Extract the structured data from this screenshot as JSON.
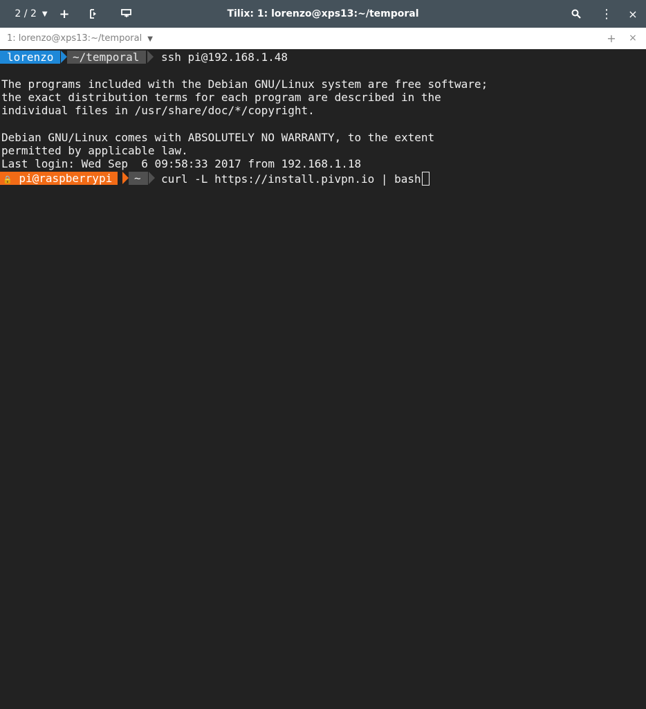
{
  "window": {
    "session_label": "2 / 2",
    "title": "Tilix: 1: lorenzo@xps13:~/temporal"
  },
  "tab": {
    "title": "1: lorenzo@xps13:~/temporal"
  },
  "terminal": {
    "prompt1": {
      "user": "lorenzo",
      "dir": "~/temporal",
      "command": "ssh pi@192.168.1.48"
    },
    "output": [
      "The programs included with the Debian GNU/Linux system are free software;",
      "the exact distribution terms for each program are described in the",
      "individual files in /usr/share/doc/*/copyright.",
      "Debian GNU/Linux comes with ABSOLUTELY NO WARRANTY, to the extent",
      "permitted by applicable law.",
      "Last login: Wed Sep  6 09:58:33 2017 from 192.168.1.18"
    ],
    "prompt2": {
      "lock": "🔒",
      "user": "pi@raspberrypi",
      "dir": "~",
      "command": "curl -L https://install.pivpn.io | bash"
    }
  },
  "icons": {
    "add": "+",
    "split": "split-icon",
    "sync": "sync-input-icon",
    "search": "search-icon",
    "menu": "⋮",
    "close": "×"
  },
  "colors": {
    "prompt_blue": "#1e88d8",
    "prompt_orange": "#f26b16",
    "prompt_grey": "#505050",
    "titlebar": "#45525b",
    "background": "#222222"
  }
}
